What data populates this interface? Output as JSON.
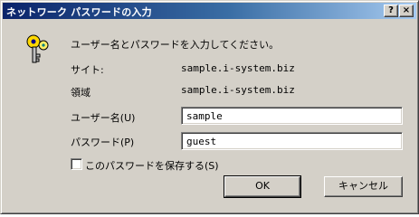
{
  "window": {
    "title": "ネットワーク パスワードの入力",
    "help_button": "?",
    "close_button": "×"
  },
  "prompt": "ユーザー名とパスワードを入力してください。",
  "site": {
    "label": "サイト:",
    "value": "sample.i-system.biz"
  },
  "realm": {
    "label": "領域",
    "value": "sample.i-system.biz"
  },
  "username": {
    "label": "ユーザー名(U)",
    "value": "sample"
  },
  "password": {
    "label": "パスワード(P)",
    "value": "guest"
  },
  "save_password": {
    "label": "このパスワードを保存する(S)",
    "checked": false
  },
  "buttons": {
    "ok": "OK",
    "cancel": "キャンセル"
  },
  "icons": {
    "dialog_icon": "key-icon"
  },
  "colors": {
    "titlebar_start": "#0a246a",
    "titlebar_end": "#a6caf0",
    "face": "#d4d0c8"
  }
}
